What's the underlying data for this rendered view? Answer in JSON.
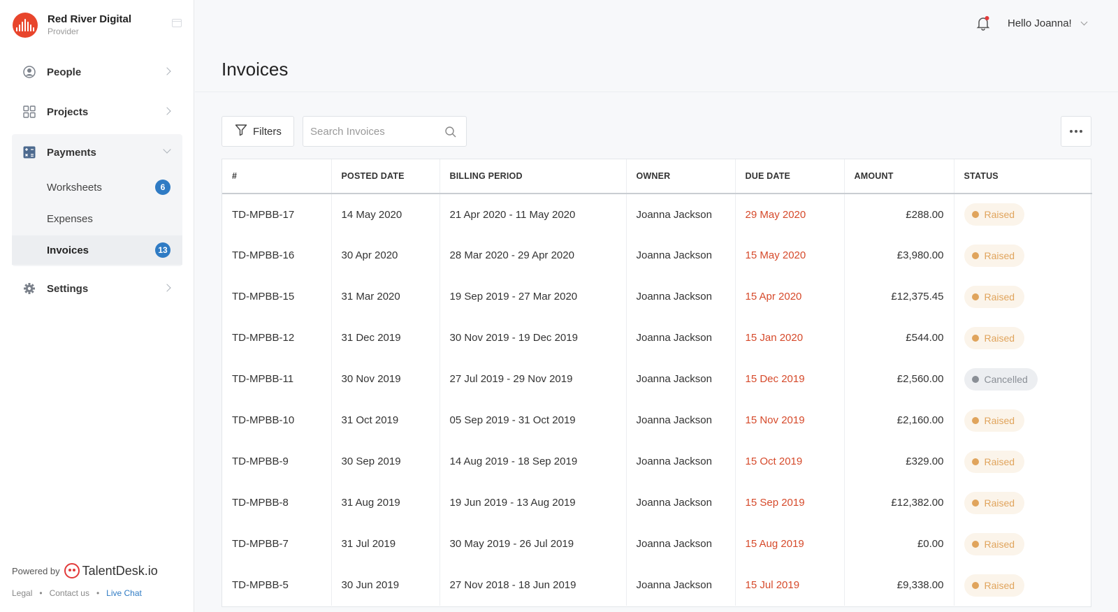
{
  "brand": {
    "name": "Red River Digital",
    "role": "Provider"
  },
  "nav": {
    "people": "People",
    "projects": "Projects",
    "payments": "Payments",
    "settings": "Settings",
    "sub": [
      {
        "label": "Worksheets",
        "count": "6"
      },
      {
        "label": "Expenses",
        "count": ""
      },
      {
        "label": "Invoices",
        "count": "13"
      }
    ]
  },
  "footer": {
    "powered_by": "Powered by",
    "product": "TalentDesk.io",
    "links": [
      "Legal",
      "Contact us",
      "Live Chat"
    ],
    "separator": "•"
  },
  "topbar": {
    "greeting": "Hello Joanna!"
  },
  "page": {
    "title": "Invoices"
  },
  "toolbar": {
    "filters_label": "Filters",
    "search_placeholder": "Search Invoices"
  },
  "table": {
    "columns": [
      "#",
      "POSTED DATE",
      "BILLING PERIOD",
      "OWNER",
      "DUE DATE",
      "AMOUNT",
      "STATUS"
    ],
    "rows": [
      {
        "id": "TD-MPBB-17",
        "posted": "14 May 2020",
        "period": "21 Apr 2020 - 11 May 2020",
        "owner": "Joanna Jackson",
        "due": "29 May 2020",
        "amount": "£288.00",
        "status": "Raised"
      },
      {
        "id": "TD-MPBB-16",
        "posted": "30 Apr 2020",
        "period": "28 Mar 2020 - 29 Apr 2020",
        "owner": "Joanna Jackson",
        "due": "15 May 2020",
        "amount": "£3,980.00",
        "status": "Raised"
      },
      {
        "id": "TD-MPBB-15",
        "posted": "31 Mar 2020",
        "period": "19 Sep 2019 - 27 Mar 2020",
        "owner": "Joanna Jackson",
        "due": "15 Apr 2020",
        "amount": "£12,375.45",
        "status": "Raised"
      },
      {
        "id": "TD-MPBB-12",
        "posted": "31 Dec 2019",
        "period": "30 Nov 2019 - 19 Dec 2019",
        "owner": "Joanna Jackson",
        "due": "15 Jan 2020",
        "amount": "£544.00",
        "status": "Raised"
      },
      {
        "id": "TD-MPBB-11",
        "posted": "30 Nov 2019",
        "period": "27 Jul 2019 - 29 Nov 2019",
        "owner": "Joanna Jackson",
        "due": "15 Dec 2019",
        "amount": "£2,560.00",
        "status": "Cancelled"
      },
      {
        "id": "TD-MPBB-10",
        "posted": "31 Oct 2019",
        "period": "05 Sep 2019 - 31 Oct 2019",
        "owner": "Joanna Jackson",
        "due": "15 Nov 2019",
        "amount": "£2,160.00",
        "status": "Raised"
      },
      {
        "id": "TD-MPBB-9",
        "posted": "30 Sep 2019",
        "period": "14 Aug 2019 - 18 Sep 2019",
        "owner": "Joanna Jackson",
        "due": "15 Oct 2019",
        "amount": "£329.00",
        "status": "Raised"
      },
      {
        "id": "TD-MPBB-8",
        "posted": "31 Aug 2019",
        "period": "19 Jun 2019 - 13 Aug 2019",
        "owner": "Joanna Jackson",
        "due": "15 Sep 2019",
        "amount": "£12,382.00",
        "status": "Raised"
      },
      {
        "id": "TD-MPBB-7",
        "posted": "31 Jul 2019",
        "period": "30 May 2019 - 26 Jul 2019",
        "owner": "Joanna Jackson",
        "due": "15 Aug 2019",
        "amount": "£0.00",
        "status": "Raised"
      },
      {
        "id": "TD-MPBB-5",
        "posted": "30 Jun 2019",
        "period": "27 Nov 2018 - 18 Jun 2019",
        "owner": "Joanna Jackson",
        "due": "15 Jul 2019",
        "amount": "£9,338.00",
        "status": "Raised"
      }
    ]
  },
  "colors": {
    "brand": "#e8452c",
    "due": "#d64a2b",
    "badge": "#2f7bc4",
    "raised": "#e0a45c",
    "cancelled": "#8a8f96"
  },
  "icons": {
    "people": "user-circle-icon",
    "projects": "grid-icon",
    "payments": "calculator-icon",
    "settings": "gear-icon",
    "notifications": "bell-icon",
    "search": "search-icon",
    "filters": "funnel-icon",
    "more": "more-dots-icon"
  }
}
